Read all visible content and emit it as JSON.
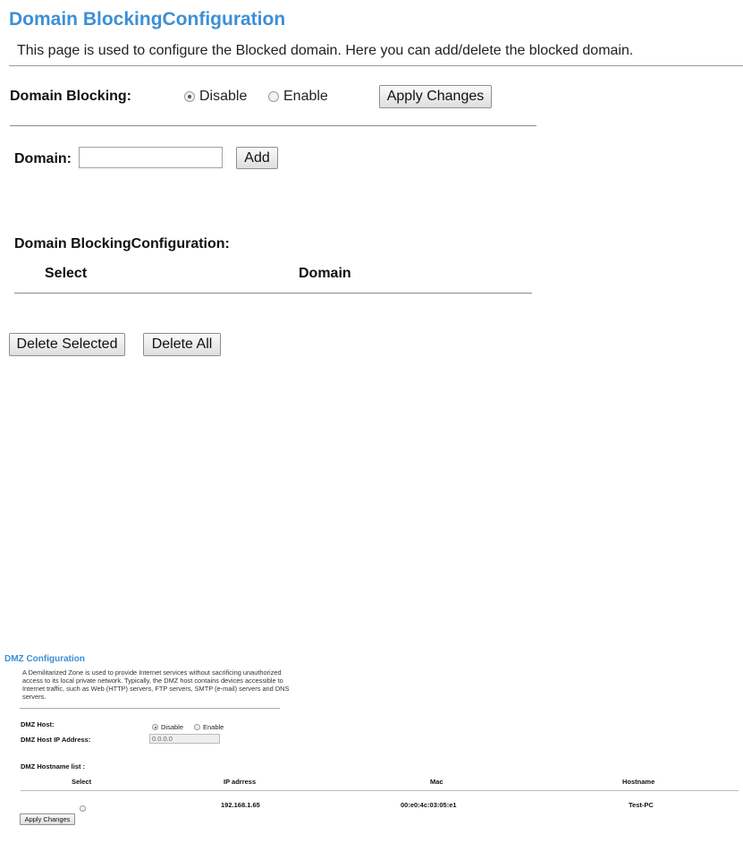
{
  "domain_section": {
    "title": "Domain BlockingConfiguration",
    "description": "This page is used to configure the Blocked domain. Here you can add/delete the blocked domain.",
    "blocking_label": "Domain Blocking:",
    "radio_disable": "Disable",
    "radio_enable": "Enable",
    "selected": "Disable",
    "apply_label": "Apply Changes",
    "domain_label": "Domain:",
    "domain_value": "",
    "add_label": "Add",
    "table_title": "Domain BlockingConfiguration:",
    "col_select": "Select",
    "col_domain": "Domain",
    "delete_selected_label": "Delete Selected",
    "delete_all_label": "Delete All"
  },
  "dmz_section": {
    "title": "DMZ Configuration",
    "description": "A Demilitarized Zone is used to provide Internet services without sacrificing unauthorized access to its local private network. Typically, the DMZ host contains devices accessible to Internet traffic, such as Web (HTTP) servers, FTP servers, SMTP (e-mail) servers and DNS servers.",
    "host_label": "DMZ Host:",
    "radio_disable": "Disable",
    "radio_enable": "Enable",
    "selected": "Disable",
    "ip_label": "DMZ Host IP Address:",
    "ip_value": "0.0.0.0",
    "list_title": "DMZ Hostname list :",
    "columns": [
      "Select",
      "IP adrress",
      "Mac",
      "Hostname"
    ],
    "rows": [
      {
        "ip": "192.168.1.65",
        "mac": "00:e0:4c:03:05:e1",
        "hostname": "Test-PC"
      }
    ],
    "apply_label": "Apply Changes"
  }
}
